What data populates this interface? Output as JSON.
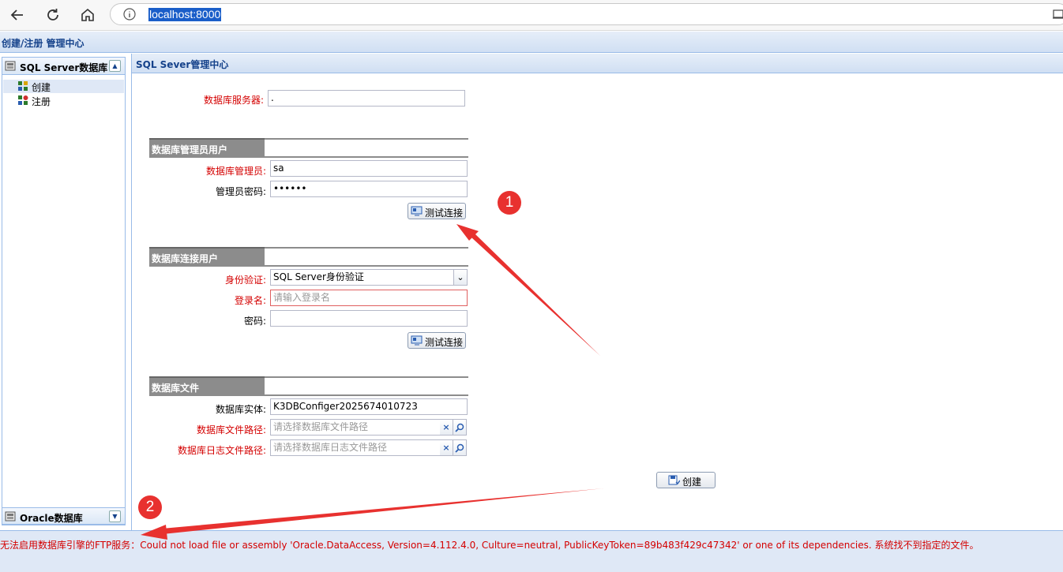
{
  "browser": {
    "url": "localhost:8000"
  },
  "app": {
    "title": "创建/注册 管理中心"
  },
  "sidebar": {
    "sections": [
      {
        "label": "SQL Server数据库",
        "icon": "database-icon",
        "expanded": true,
        "items": [
          {
            "label": "创建",
            "icon": "create-icon",
            "selected": true
          },
          {
            "label": "注册",
            "icon": "register-icon",
            "selected": false
          }
        ]
      },
      {
        "label": "Oracle数据库",
        "icon": "database-icon",
        "expanded": false,
        "items": []
      }
    ]
  },
  "main": {
    "title": "SQL Sever管理中心",
    "server": {
      "label": "数据库服务器:",
      "value": "."
    },
    "admin": {
      "section_title": "数据库管理员用户",
      "user_label": "数据库管理员:",
      "user_value": "sa",
      "password_label": "管理员密码:",
      "password_value": "••••••",
      "test_button": "测试连接"
    },
    "connection": {
      "section_title": "数据库连接用户",
      "auth_label": "身份验证:",
      "auth_value": "SQL Server身份验证",
      "login_label": "登录名:",
      "login_placeholder": "请输入登录名",
      "password_label": "密码:",
      "password_value": "",
      "test_button": "测试连接"
    },
    "files": {
      "section_title": "数据库文件",
      "instance_label": "数据库实体:",
      "instance_value": "K3DBConfiger2025674010723",
      "file_path_label": "数据库文件路径:",
      "file_path_placeholder": "请选择数据库文件路径",
      "log_path_label": "数据库日志文件路径:",
      "log_path_placeholder": "请选择数据库日志文件路径"
    },
    "create_button": "创建"
  },
  "status": {
    "message": "无法启用数据库引擎的FTP服务：Could not load file or assembly 'Oracle.DataAccess, Version=4.112.4.0, Culture=neutral, PublicKeyToken=89b483f429c47342' or one of its dependencies. 系统找不到指定的文件。"
  },
  "annotations": {
    "marker_1": "1",
    "marker_2": "2",
    "color": "#e8312f"
  }
}
